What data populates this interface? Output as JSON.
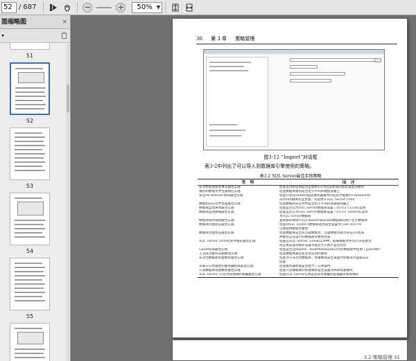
{
  "toolbar": {
    "current_page": "52",
    "separator": "/",
    "total_pages": "687",
    "zoom": "50%",
    "zoom_options": [
      "50%"
    ]
  },
  "sidebar": {
    "title": "面缩略图",
    "close": "×",
    "thumbnails": [
      {
        "label": "51"
      },
      {
        "label": "52"
      },
      {
        "label": "53"
      },
      {
        "label": "54"
      },
      {
        "label": "55"
      }
    ]
  },
  "page": {
    "header_page": "30",
    "header_chapter": "第 3 章",
    "header_title": "策略管理",
    "figure_caption": "图3-12 “Import”对话框",
    "paragraph": "表3-2中列出了可以导入到数据库引擎使用的策略。",
    "table_caption": "表3.2  SQL Server最佳实践策略",
    "table_headers": [
      "策　略",
      "描　述"
    ],
    "table_rows": [
      [
        "非对称密钥加密算法最佳实践",
        "检查非对称密钥是否是使用1024位或更高的加密强度创建的"
      ],
      [
        "备份和数据文件位置相应实践",
        "检查数据库备份是否位于不同的磁盘设备上"
      ],
      [
        "安全的CmdExec权限最佳实践",
        "检查只有sysadmin固定服务器角色的成员才能执行CmdExec和"
      ],
      [
        "",
        "ActiveX脚本作业步骤，仅适用于SQL Server 2000"
      ],
      [
        "数据和日志文件位置最佳实践",
        "检查数据和日志文件是否位于不同的逻辑驱动器上"
      ],
      [
        "数据库自动关闭最佳实践",
        "检查是否已为SQL Server数据库设置了AUTO_CLOSE选项"
      ],
      [
        "数据库自动收缩最佳实践",
        "检查是否已为SQL Server数据库设置了AUTO_SHRINK选项"
      ],
      [
        "",
        "为SQL Server数据库"
      ],
      [
        "数据库排序规则最佳实践",
        "查找排序规则不同于master或model数据库的用户定义数据库"
      ],
      [
        "数据库页面验证最佳实践",
        "检查PAGE_VERIFY数据库选项是否设置为CHECKSUM"
      ],
      [
        "",
        "以便提供数据完整性"
      ],
      [
        "数据库页面状态最佳实践",
        "检查数据库是否有可疑数据页，可疑数据页表示存在I/O错误"
      ],
      [
        "",
        "并报告正在运行的数据库完整性检查"
      ],
      [
        "SQL Server 2000的文件增长最佳实践",
        "检查在SQL Server 2000的实例中，如果数据文件为1GB或更大"
      ],
      [
        "",
        "则应将其自动增长设置为固定大小而不是百分比"
      ],
      [
        "Guest权限最佳实践",
        "检查是否在master、msdb和tempdb以外的数据库中启用了guest用户"
      ],
      [
        "上次成功备份日期最佳实践",
        "检查数据库最近是否有成功的备份"
      ],
      [
        "非对话数据库恢复模式最佳实践",
        "检查对于非对话数据库，恢复模式是否设置为完整或大容量日志"
      ],
      [
        "",
        "恢复"
      ],
      [
        "从属于公共角色的服务器权限最佳实践",
        "检查服务器权限是否授予了公共角色"
      ],
      [
        "只读数据库恢复模式最佳实践",
        "检查只读数据库的恢复模式是否设置为简单恢复模式"
      ],
      [
        "SQL Server 32位亲和性掩码重叠最佳实践",
        "检查SQL Server实例是否具有重叠的处理器亲和性掩码"
      ]
    ]
  },
  "next_page": {
    "footer": "3.2  策略管理  31"
  }
}
